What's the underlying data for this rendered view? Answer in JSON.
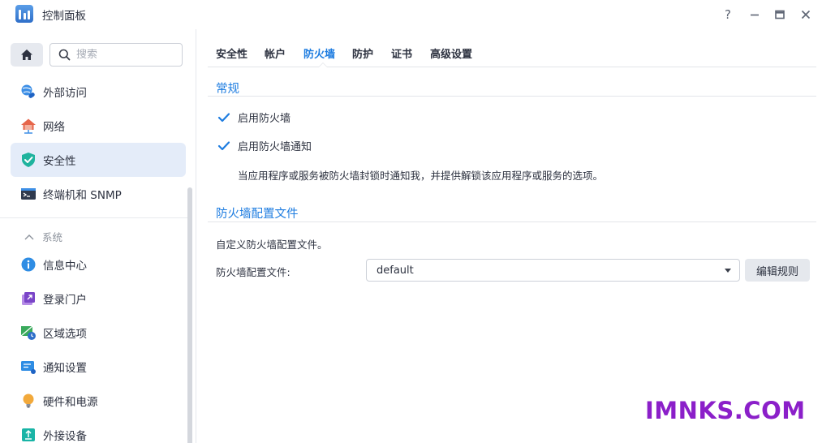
{
  "window": {
    "title": "控制面板",
    "help": "?",
    "minimize": "—",
    "maximize": "□",
    "close": "✕"
  },
  "sidebar": {
    "search_placeholder": "搜索",
    "items": [
      {
        "label": "外部访问",
        "icon": "globe-link-icon"
      },
      {
        "label": "网络",
        "icon": "house-network-icon"
      },
      {
        "label": "安全性",
        "icon": "shield-check-icon",
        "active": true
      },
      {
        "label": "终端机和 SNMP",
        "icon": "terminal-icon"
      }
    ],
    "section": {
      "label": "系统",
      "icon": "chevron-up-icon"
    },
    "system_items": [
      {
        "label": "信息中心",
        "icon": "info-icon"
      },
      {
        "label": "登录门户",
        "icon": "login-portal-icon"
      },
      {
        "label": "区域选项",
        "icon": "region-clock-icon"
      },
      {
        "label": "通知设置",
        "icon": "notification-icon"
      },
      {
        "label": "硬件和电源",
        "icon": "bulb-icon"
      },
      {
        "label": "外接设备",
        "icon": "external-device-icon"
      }
    ]
  },
  "tabs": [
    "安全性",
    "帐户",
    "防火墙",
    "防护",
    "证书",
    "高级设置"
  ],
  "active_tab": "防火墙",
  "general": {
    "title": "常规",
    "enable_firewall": {
      "label": "启用防火墙",
      "checked": true
    },
    "enable_notify": {
      "label": "启用防火墙通知",
      "checked": true
    },
    "notify_desc": "当应用程序或服务被防火墙封锁时通知我，并提供解锁该应用程序或服务的选项。"
  },
  "profile": {
    "title": "防火墙配置文件",
    "desc": "自定义防火墙配置文件。",
    "field_label": "防火墙配置文件:",
    "selected": "default",
    "edit_button": "编辑规则"
  },
  "watermark": "IMNKS.COM",
  "colors": {
    "accent": "#1d7ce0",
    "active_bg": "#e4ecf9",
    "watermark": "#8b1fc9"
  }
}
